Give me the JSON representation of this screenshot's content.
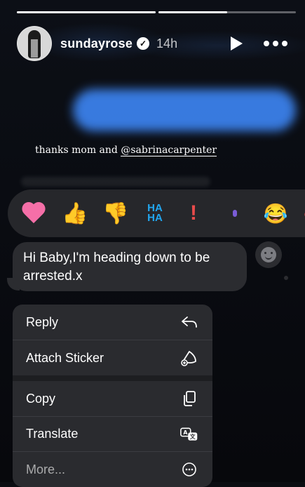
{
  "story": {
    "username": "sundayrose",
    "time_ago": "14h",
    "caption_prefix": "thanks mom and ",
    "caption_mention": "@sabrinacarpenter"
  },
  "reactions": {
    "haha_top": "HA",
    "haha_bottom": "HA",
    "exclamation": "!",
    "laugh": "😂",
    "thumbs_up": "👍",
    "thumbs_down": "👎"
  },
  "message": {
    "text": "Hi Baby,I'm heading down to be arrested.x"
  },
  "menu": {
    "items": [
      {
        "label": "Reply",
        "icon": "reply-icon"
      },
      {
        "label": "Attach Sticker",
        "icon": "sticker-icon"
      },
      {
        "label": "Copy",
        "icon": "copy-icon"
      },
      {
        "label": "Translate",
        "icon": "translate-icon"
      },
      {
        "label": "More...",
        "icon": "more-icon"
      }
    ]
  },
  "colors": {
    "bubble_gray": "#2b2c30",
    "blue_blur": "#3d86f5",
    "heart_pink": "#f56fa8",
    "haha_blue": "#22a7f0"
  }
}
